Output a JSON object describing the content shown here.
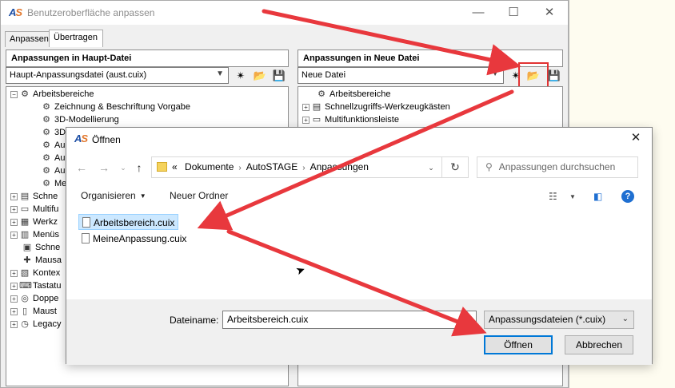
{
  "main_window": {
    "title": "Benutzeroberfläche anpassen",
    "logo_a": "A",
    "logo_s": "S",
    "controls": {
      "minimize": "—",
      "maximize": "☐",
      "close": "✕"
    },
    "tabs": [
      {
        "label": "Anpassen"
      },
      {
        "label": "Übertragen"
      }
    ],
    "left": {
      "header": "Anpassungen in Haupt-Datei",
      "combo_value": "Haupt-Anpassungsdatei (aust.cuix)"
    },
    "right": {
      "header": "Anpassungen in Neue Datei",
      "combo_value": "Neue Datei"
    },
    "left_tree": [
      {
        "label": "Arbeitsbereiche"
      },
      {
        "label": "Zeichnung & Beschriftung Vorgabe"
      },
      {
        "label": "3D-Modellierung"
      },
      {
        "label": "3D"
      },
      {
        "label": "Au"
      },
      {
        "label": "Au"
      },
      {
        "label": "Au"
      },
      {
        "label": "Me"
      },
      {
        "label": "Schne"
      },
      {
        "label": "Multifu"
      },
      {
        "label": "Werkz"
      },
      {
        "label": "Menüs"
      },
      {
        "label": "Schne"
      },
      {
        "label": "Mausa"
      },
      {
        "label": "Kontex"
      },
      {
        "label": "Tastatu"
      },
      {
        "label": "Doppe"
      },
      {
        "label": "Maust"
      },
      {
        "label": "Legacy"
      }
    ],
    "right_tree": [
      {
        "label": "Arbeitsbereiche"
      },
      {
        "label": "Schnellzugriffs-Werkzeugkästen"
      },
      {
        "label": "Multifunktionsleiste"
      }
    ]
  },
  "dialog": {
    "title": "Öffnen",
    "logo_a": "A",
    "logo_s": "S",
    "close": "✕",
    "breadcrumb": [
      "Dokumente",
      "AutoSTAGE",
      "Anpassungen"
    ],
    "breadcrumb_prefix": "«",
    "search_placeholder": "Anpassungen durchsuchen",
    "organize": "Organisieren",
    "new_folder": "Neuer Ordner",
    "help": "?",
    "files": [
      {
        "name": "Arbeitsbereich.cuix",
        "selected": true
      },
      {
        "name": "MeineAnpassung.cuix",
        "selected": false
      }
    ],
    "filename_label": "Dateiname:",
    "filename_value": "Arbeitsbereich.cuix",
    "filetype_value": "Anpassungsdateien (*.cuix)",
    "open_button": "Öffnen",
    "cancel_button": "Abbrechen"
  },
  "colors": {
    "annotation_arrow": "#e8383d",
    "selection": "#cce8ff",
    "accent": "#0078d7"
  }
}
